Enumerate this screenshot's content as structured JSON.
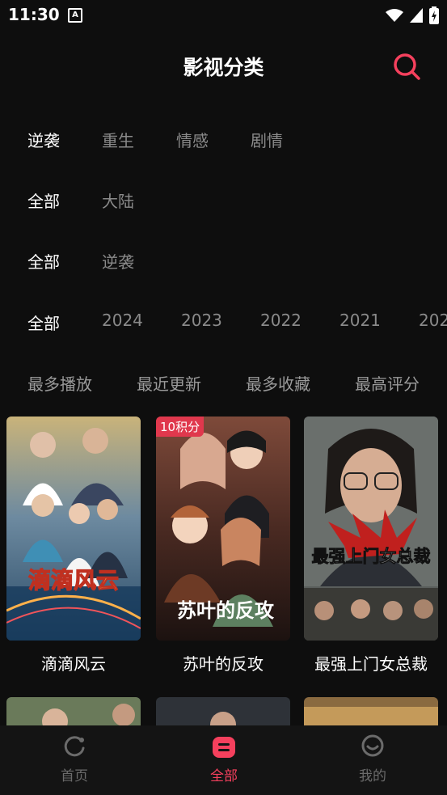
{
  "status_bar": {
    "time": "11:30",
    "notif": "A"
  },
  "header": {
    "title": "影视分类"
  },
  "filters": {
    "genre": [
      "逆袭",
      "重生",
      "情感",
      "剧情"
    ],
    "region": [
      "全部",
      "大陆"
    ],
    "tag": [
      "全部",
      "逆袭"
    ],
    "year": [
      "全部",
      "2024",
      "2023",
      "2022",
      "2021",
      "202"
    ],
    "sort": [
      "最多播放",
      "最近更新",
      "最多收藏",
      "最高评分"
    ]
  },
  "cards": [
    {
      "title": "滴滴风云",
      "poster_text": "滴滴风云",
      "badge": ""
    },
    {
      "title": "苏叶的反攻",
      "poster_text": "苏叶的反攻",
      "badge": "10积分"
    },
    {
      "title": "最强上门女总裁",
      "poster_text": "最强上门女总裁",
      "badge": ""
    }
  ],
  "tabbar": {
    "home": "首页",
    "all": "全部",
    "mine": "我的"
  },
  "colors": {
    "accent": "#f5405d",
    "background": "#0e0e0e"
  }
}
